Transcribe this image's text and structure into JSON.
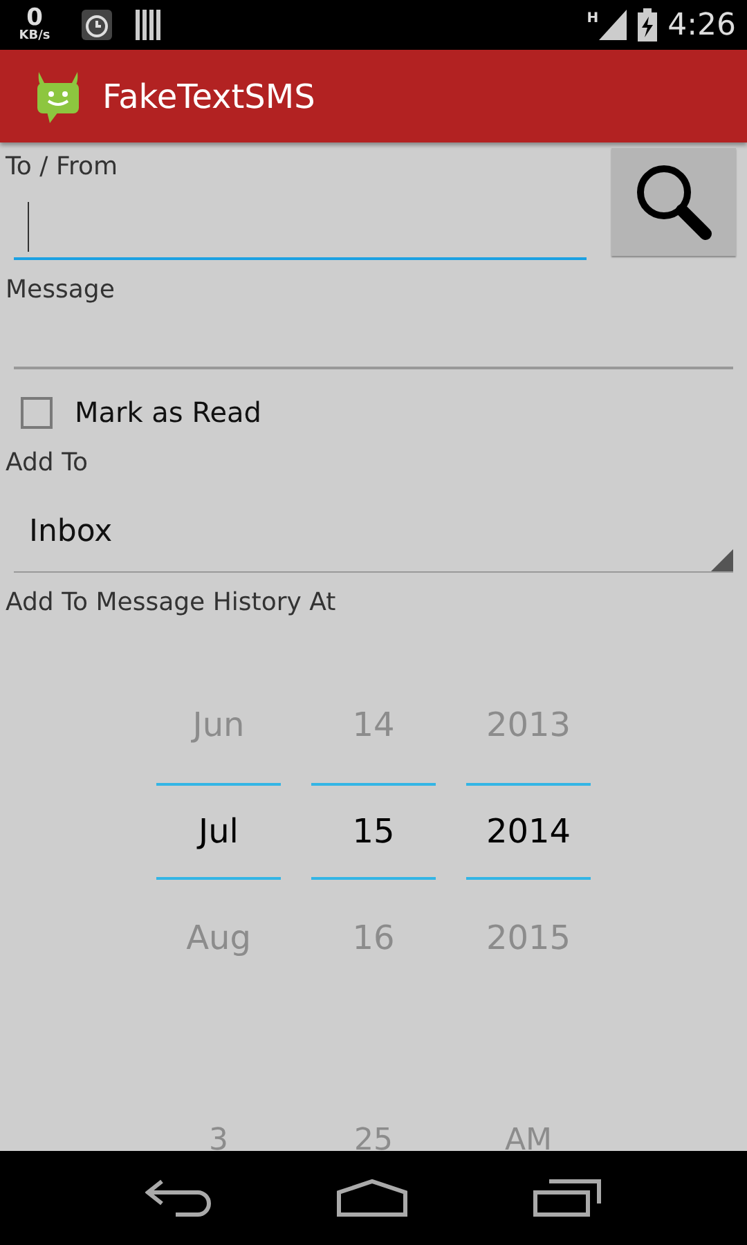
{
  "status_bar": {
    "speed": "0",
    "speed_unit": "KB/s",
    "network": "H",
    "time": "4:26"
  },
  "app_bar": {
    "title": "FakeTextSMS"
  },
  "to_from": {
    "label": "To / From",
    "focused": true
  },
  "message": {
    "label": "Message",
    "focused": false
  },
  "mark_as_read": {
    "label": "Mark as Read",
    "checked": false
  },
  "add_to": {
    "label": "Add To",
    "value": "Inbox"
  },
  "history": {
    "label": "Add To Message History At"
  },
  "date_picker": [
    {
      "previous": "Jun",
      "current": "Jul",
      "next": "Aug"
    },
    {
      "previous": "14",
      "current": "15",
      "next": "16"
    },
    {
      "previous": "2013",
      "current": "2014",
      "next": "2015"
    }
  ],
  "time_picker": [
    "3",
    "25",
    "AM"
  ]
}
